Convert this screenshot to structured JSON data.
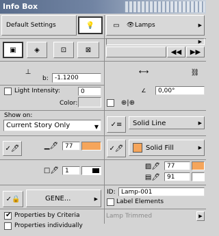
{
  "window": {
    "title": "Info Box"
  },
  "top": {
    "default_settings": "Default Settings",
    "lamps_label": "Lamps"
  },
  "nav": {
    "prev": "◀◀",
    "next": "▶▶"
  },
  "dims": {
    "b_label": "b:",
    "b_value": "-1.1200",
    "angle_value": "0,00°"
  },
  "light": {
    "intensity_label": "Light Intensity:",
    "intensity_value": "0",
    "color_label": "Color:"
  },
  "show_on": {
    "label": "Show on:",
    "value": "Current Story Only"
  },
  "line": {
    "type": "Solid Line"
  },
  "pens": {
    "pen1": "77",
    "pen2": "1",
    "pen3": "77",
    "pen4": "91"
  },
  "fill": {
    "type": "Solid Fill"
  },
  "gene": {
    "label": "GENE..."
  },
  "id": {
    "label": "ID:",
    "value": "Lamp-001",
    "label_elements": "Label Elements"
  },
  "properties": {
    "by_criteria": "Properties by Criteria",
    "individually": "Properties individually"
  },
  "lamp_trimmed": "Lamp Trimmed",
  "colors": {
    "accent_orange": "#f5a55b",
    "titlebar": "#5a6d8c"
  }
}
